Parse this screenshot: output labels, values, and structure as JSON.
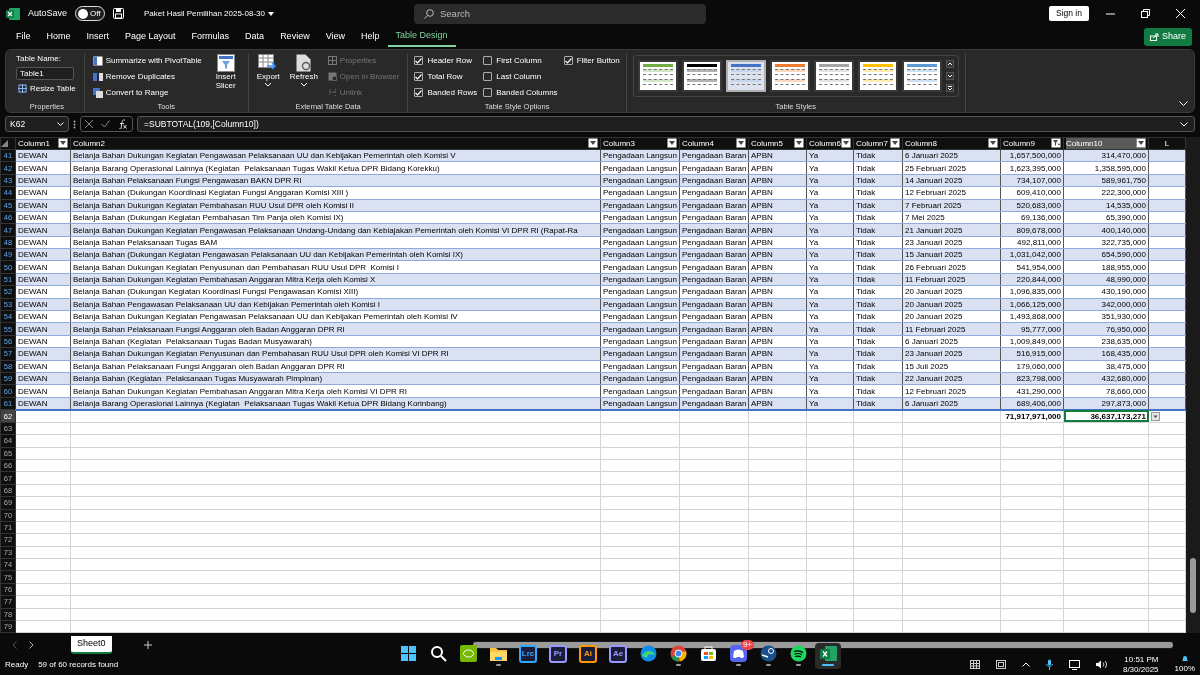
{
  "title_bar": {
    "autosave_label": "AutoSave",
    "autosave_state": "Off",
    "autosave_on": false,
    "file_name": "Paket Hasil Pemilihan 2025-08-30",
    "search_placeholder": "Search",
    "sign_in": "Sign in"
  },
  "menu_tabs": [
    {
      "label": "File",
      "selected": false
    },
    {
      "label": "Home",
      "selected": false
    },
    {
      "label": "Insert",
      "selected": false
    },
    {
      "label": "Page Layout",
      "selected": false
    },
    {
      "label": "Formulas",
      "selected": false
    },
    {
      "label": "Data",
      "selected": false
    },
    {
      "label": "Review",
      "selected": false
    },
    {
      "label": "View",
      "selected": false
    },
    {
      "label": "Help",
      "selected": false
    },
    {
      "label": "Table Design",
      "selected": true
    }
  ],
  "share": "Share",
  "ribbon": {
    "properties": {
      "title": "Properties",
      "table_name_label": "Table Name:",
      "table_name": "Table1",
      "resize": "Resize Table"
    },
    "tools": {
      "title": "Tools",
      "items": [
        "Summarize with PivotTable",
        "Remove Duplicates",
        "Convert to Range"
      ],
      "slicer": "Insert Slicer"
    },
    "external": {
      "title": "External Table Data",
      "export": "Export",
      "refresh": "Refresh",
      "items": [
        {
          "label": "Properties",
          "disabled": true
        },
        {
          "label": "Open in Browser",
          "disabled": true
        },
        {
          "label": "Unlink",
          "disabled": true
        }
      ]
    },
    "options": {
      "title": "Table Style Options",
      "checkboxes": [
        {
          "label": "Header Row",
          "checked": true
        },
        {
          "label": "Total Row",
          "checked": true
        },
        {
          "label": "Banded Rows",
          "checked": true
        },
        {
          "label": "First Column",
          "checked": false
        },
        {
          "label": "Last Column",
          "checked": false
        },
        {
          "label": "Banded Columns",
          "checked": false
        },
        {
          "label": "Filter Button",
          "checked": true
        }
      ]
    },
    "styles": {
      "title": "Table Styles",
      "swatches": [
        {
          "color": "#70ad47",
          "selected": false
        },
        {
          "color": "#000000",
          "selected": false
        },
        {
          "color": "#4472c4",
          "selected": true
        },
        {
          "color": "#ed7d31",
          "selected": false
        },
        {
          "color": "#a5a5a5",
          "selected": false
        },
        {
          "color": "#ffc000",
          "selected": false
        },
        {
          "color": "#5b9bd5",
          "selected": false
        }
      ]
    }
  },
  "formula_bar": {
    "name_box": "K62",
    "formula": "=SUBTOTAL(109,[Column10])"
  },
  "sheet": {
    "columns": [
      {
        "label": "Column1",
        "numeric": false,
        "filtered": false,
        "selected": false
      },
      {
        "label": "Column2",
        "numeric": false,
        "filtered": false,
        "selected": false
      },
      {
        "label": "Column3",
        "numeric": false,
        "filtered": false,
        "selected": false
      },
      {
        "label": "Column4",
        "numeric": false,
        "filtered": false,
        "selected": false
      },
      {
        "label": "Column5",
        "numeric": false,
        "filtered": false,
        "selected": false
      },
      {
        "label": "Column6",
        "numeric": false,
        "filtered": false,
        "selected": false
      },
      {
        "label": "Column7",
        "numeric": false,
        "filtered": false,
        "selected": false
      },
      {
        "label": "Column8",
        "numeric": false,
        "filtered": false,
        "selected": false
      },
      {
        "label": "Column9",
        "numeric": true,
        "filtered": true,
        "selected": false
      },
      {
        "label": "Column10",
        "numeric": true,
        "filtered": false,
        "selected": true
      }
    ],
    "extra_column": "L",
    "rows": [
      {
        "number": "41",
        "cells": [
          "DEWAN",
          "Belanja Bahan Dukungan Kegiatan Pengawasan Pelaksanaan UU dan Kebijakan Pemerintah oleh Komisi V",
          "Pengadaan Langsun",
          "Pengadaan Baran",
          "APBN",
          "Ya",
          "Tidak",
          "6 Januari 2025",
          "1,657,500,000",
          "314,470,000"
        ]
      },
      {
        "number": "42",
        "cells": [
          "DEWAN",
          "Belanja Barang Operasional Lainnya (Kegiatan  Pelaksanaan Tugas Wakil Ketua DPR Bidang Korekku)",
          "Pengadaan Langsun",
          "Pengadaan Baran",
          "APBN",
          "Ya",
          "Tidak",
          "25 Februari 2025",
          "1,623,395,000",
          "1,358,595,000"
        ]
      },
      {
        "number": "43",
        "cells": [
          "DEWAN",
          "Belanja Bahan Pelaksanaan Fungsi Pengawasan BAKN DPR RI",
          "Pengadaan Langsun",
          "Pengadaan Baran",
          "APBN",
          "Ya",
          "Tidak",
          "14 Januari 2025",
          "734,107,000",
          "589,961,750"
        ]
      },
      {
        "number": "44",
        "cells": [
          "DEWAN",
          "Belanja Bahan (Dukungan Koordinasi Kegiatan Fungsi Anggaran Komisi XIII )",
          "Pengadaan Langsun",
          "Pengadaan Baran",
          "APBN",
          "Ya",
          "Tidak",
          "12 Februari 2025",
          "609,410,000",
          "222,300,000"
        ]
      },
      {
        "number": "45",
        "cells": [
          "DEWAN",
          "Belanja Bahan Dukungan Kegiatan Pembahasan RUU Usul DPR oleh Komisi II",
          "Pengadaan Langsun",
          "Pengadaan Baran",
          "APBN",
          "Ya",
          "Tidak",
          "7 Februari 2025",
          "520,683,000",
          "14,535,000"
        ]
      },
      {
        "number": "46",
        "cells": [
          "DEWAN",
          "Belanja Bahan (Dukungan Kegiatan Pembahasan Tim Panja oleh Komisi IX)",
          "Pengadaan Langsun",
          "Pengadaan Baran",
          "APBN",
          "Ya",
          "Tidak",
          "7 Mei 2025",
          "69,136,000",
          "65,390,000"
        ]
      },
      {
        "number": "47",
        "cells": [
          "DEWAN",
          "Belanja Bahan Dukungan Kegiatan Pengawasan Pelaksanaan Undang-Undang dan Kebiajakan Pemerintah oleh Komisi VI DPR RI (Rapat-Ra",
          "Pengadaan Langsun",
          "Pengadaan Baran",
          "APBN",
          "Ya",
          "Tidak",
          "21 Januari 2025",
          "809,678,000",
          "400,140,000"
        ]
      },
      {
        "number": "48",
        "cells": [
          "DEWAN",
          "Belanja Bahan Pelaksanaan Tugas BAM",
          "Pengadaan Langsun",
          "Pengadaan Baran",
          "APBN",
          "Ya",
          "Tidak",
          "23 Januari 2025",
          "492,811,000",
          "322,735,000"
        ]
      },
      {
        "number": "49",
        "cells": [
          "DEWAN",
          "Belanja Bahan (Dukungan Kegiatan Pengawasan Pelaksanaan UU dan Kebijakan Pemerintah oleh Komisi IX)",
          "Pengadaan Langsun",
          "Pengadaan Baran",
          "APBN",
          "Ya",
          "Tidak",
          "15 Januari 2025",
          "1,031,042,000",
          "654,590,000"
        ]
      },
      {
        "number": "50",
        "cells": [
          "DEWAN",
          "Belanja Bahan Dukungan Kegiatan Penyusunan dan Pembahasan RUU Usul DPR  Komisi I",
          "Pengadaan Langsun",
          "Pengadaan Baran",
          "APBN",
          "Ya",
          "Tidak",
          "26 Februari 2025",
          "541,954,000",
          "188,955,000"
        ]
      },
      {
        "number": "51",
        "cells": [
          "DEWAN",
          "Belanja Bahan Dukungan Kegiatan Pembahasan Anggaran Mitra Kerja oleh Komisi X",
          "Pengadaan Langsun",
          "Pengadaan Baran",
          "APBN",
          "Ya",
          "Tidak",
          "11 Februari 2025",
          "220,844,000",
          "48,990,000"
        ]
      },
      {
        "number": "52",
        "cells": [
          "DEWAN",
          "Belanja Bahan (Dukungan Kegiatan Koordinasi Fungsi Pengawasan Komisi XIII)",
          "Pengadaan Langsun",
          "Pengadaan Baran",
          "APBN",
          "Ya",
          "Tidak",
          "20 Januari 2025",
          "1,096,835,000",
          "430,190,000"
        ]
      },
      {
        "number": "53",
        "cells": [
          "DEWAN",
          "Belanja Bahan Pengawasan Pelaksanaan UU dan Kebijakan Pemerintah oleh Komisi I",
          "Pengadaan Langsun",
          "Pengadaan Baran",
          "APBN",
          "Ya",
          "Tidak",
          "20 Januari 2025",
          "1,066,125,000",
          "342,000,000"
        ]
      },
      {
        "number": "54",
        "cells": [
          "DEWAN",
          "Belanja Bahan Dukungan Kegiatan Pengawasan Pelaksanaan UU dan Kebijakan Pemerintah oleh Komisi IV",
          "Pengadaan Langsun",
          "Pengadaan Baran",
          "APBN",
          "Ya",
          "Tidak",
          "20 Januari 2025",
          "1,493,868,000",
          "351,930,000"
        ]
      },
      {
        "number": "55",
        "cells": [
          "DEWAN",
          "Belanja Bahan Pelaksanaan Fungsi Anggaran oleh Badan Anggaran DPR RI",
          "Pengadaan Langsun",
          "Pengadaan Baran",
          "APBN",
          "Ya",
          "Tidak",
          "11 Februari 2025",
          "95,777,000",
          "76,950,000"
        ]
      },
      {
        "number": "56",
        "cells": [
          "DEWAN",
          "Belanja Bahan (Kegiatan  Pelaksanaan Tugas Badan Musyawarah)",
          "Pengadaan Langsun",
          "Pengadaan Baran",
          "APBN",
          "Ya",
          "Tidak",
          "6 Januari 2025",
          "1,009,849,000",
          "238,635,000"
        ]
      },
      {
        "number": "57",
        "cells": [
          "DEWAN",
          "Belanja Bahan Dukungan Kegiatan Penyusunan dan Pembahasan RUU Usul DPR oleh Komisi VI DPR RI",
          "Pengadaan Langsun",
          "Pengadaan Baran",
          "APBN",
          "Ya",
          "Tidak",
          "23 Januari 2025",
          "516,915,000",
          "168,435,000"
        ]
      },
      {
        "number": "58",
        "cells": [
          "DEWAN",
          "Belanja Bahan Pelaksanaan Fungsi Anggaran oleh Badan Anggaran DPR RI",
          "Pengadaan Langsun",
          "Pengadaan Baran",
          "APBN",
          "Ya",
          "Tidak",
          "15 Juli 2025",
          "179,060,000",
          "38,475,000"
        ]
      },
      {
        "number": "59",
        "cells": [
          "DEWAN",
          "Belanja Bahan (Kegiatan  Pelaksanaan Tugas Musyawarah Pimpinan)",
          "Pengadaan Langsun",
          "Pengadaan Baran",
          "APBN",
          "Ya",
          "Tidak",
          "22 Januari 2025",
          "823,798,000",
          "432,680,000"
        ]
      },
      {
        "number": "60",
        "cells": [
          "DEWAN",
          "Belanja Bahan Dukungan Kegiatan Pembahasan Anggaran Mitra Kerja oleh Komisi VI DPR RI",
          "Pengadaan Langsun",
          "Pengadaan Baran",
          "APBN",
          "Ya",
          "Tidak",
          "12 Februari 2025",
          "431,290,000",
          "78,660,000"
        ]
      },
      {
        "number": "61",
        "cells": [
          "DEWAN",
          "Belanja Barang Operasional Lainnya (Kegiatan  Pelaksanaan Tugas Wakil Ketua DPR Bidang Korinbang)",
          "Pengadaan Langsun",
          "Pengadaan Baran",
          "APBN",
          "Ya",
          "Tidak",
          "6 Januari 2025",
          "689,406,000",
          "297,873,000"
        ]
      }
    ],
    "total_row": {
      "number": "62",
      "cells": [
        "",
        "",
        "",
        "",
        "",
        "",
        "",
        "",
        "71,917,971,000",
        "36,637,173,271"
      ]
    },
    "empty_rows": [
      "63",
      "64",
      "65",
      "66",
      "67",
      "68",
      "69",
      "70",
      "71",
      "72",
      "73",
      "74",
      "75",
      "76",
      "77",
      "78",
      "79"
    ]
  },
  "sheet_tabs": [
    {
      "label": "Sheet0",
      "selected": true
    }
  ],
  "status_bar": {
    "ready": "Ready",
    "records": "59 of 60 records found",
    "zoom": "100%"
  },
  "taskbar": {
    "apps": [
      {
        "kind": "start",
        "running": false,
        "selected": false
      },
      {
        "kind": "search",
        "running": false,
        "selected": false
      },
      {
        "kind": "gpu",
        "running": false,
        "selected": false
      },
      {
        "kind": "folder",
        "running": true,
        "selected": false
      },
      {
        "kind": "text",
        "label": "Lrc",
        "color": "#31a8ff",
        "running": false,
        "selected": false
      },
      {
        "kind": "text",
        "label": "Pr",
        "color": "#9999ff",
        "running": false,
        "selected": false
      },
      {
        "kind": "text",
        "label": "Ai",
        "color": "#ff9a00",
        "running": false,
        "selected": false
      },
      {
        "kind": "text",
        "label": "Ae",
        "color": "#9999ff",
        "running": false,
        "selected": false
      },
      {
        "kind": "browser-wave",
        "running": false,
        "selected": false
      },
      {
        "kind": "browser-ring",
        "running": true,
        "selected": false
      },
      {
        "kind": "store",
        "running": false,
        "selected": false
      },
      {
        "kind": "chat",
        "badge": "9+",
        "running": true,
        "selected": false
      },
      {
        "kind": "game",
        "running": true,
        "selected": false
      },
      {
        "kind": "music",
        "running": true,
        "selected": false
      },
      {
        "kind": "sheet",
        "running": true,
        "selected": true
      }
    ],
    "time": "10:51 PM",
    "date": "8/30/2025"
  }
}
